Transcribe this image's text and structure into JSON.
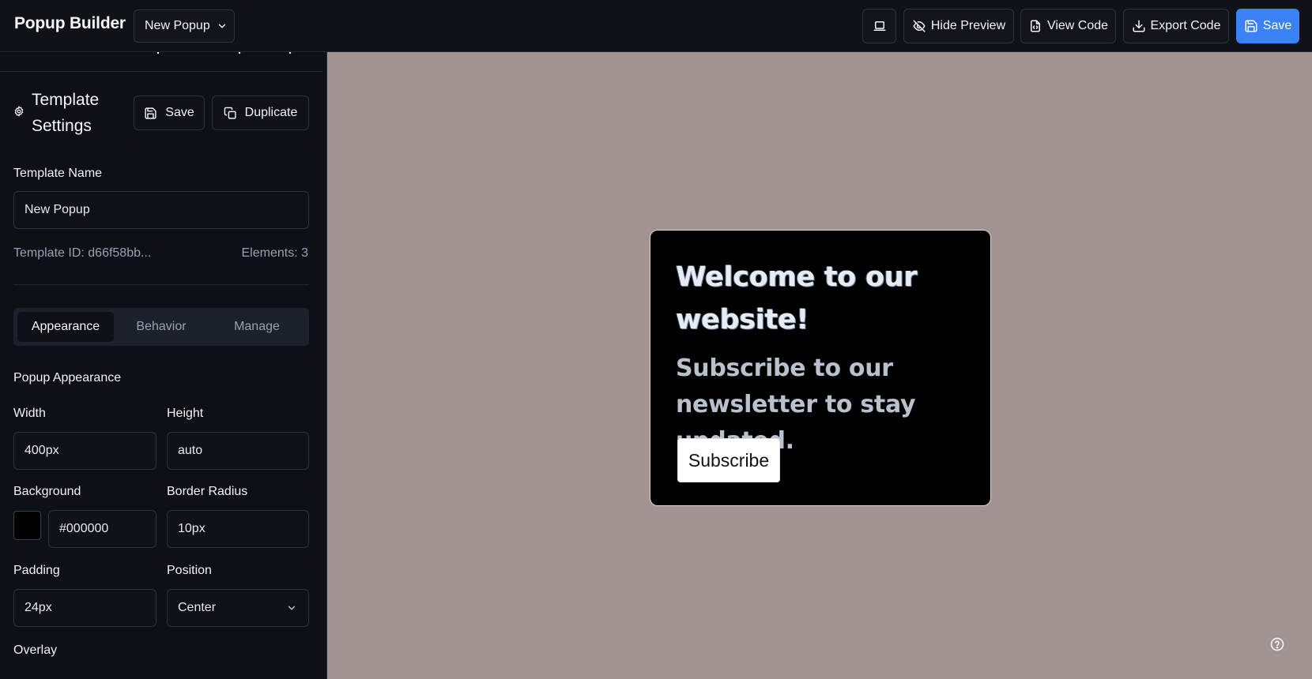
{
  "header": {
    "app_title": "Popup Builder",
    "popup_select": "New Popup",
    "device_icon": "laptop-icon",
    "hide_preview": "Hide Preview",
    "view_code": "View Code",
    "export_code": "Export Code",
    "save": "Save"
  },
  "sidebar": {
    "title": "Template Settings",
    "save": "Save",
    "duplicate": "Duplicate",
    "template_name_label": "Template Name",
    "template_name_value": "New Popup",
    "template_id_label": "Template ID:",
    "template_id_value": "d66f58bb...",
    "elements_label": "Elements:",
    "elements_value": "3",
    "tabs": [
      "Appearance",
      "Behavior",
      "Manage"
    ],
    "active_tab": "Appearance",
    "section_title": "Popup Appearance",
    "width_label": "Width",
    "width_value": "400px",
    "height_label": "Height",
    "height_value": "auto",
    "background_label": "Background",
    "background_value": "#000000",
    "border_radius_label": "Border Radius",
    "border_radius_value": "10px",
    "padding_label": "Padding",
    "padding_value": "24px",
    "position_label": "Position",
    "position_value": "Center",
    "overlay_label": "Overlay"
  },
  "preview": {
    "heading": "Welcome to our website!",
    "text": "Subscribe to our newsletter to stay updated.",
    "button": "Subscribe"
  },
  "colors": {
    "accent": "#3b82f6",
    "preview_bg": "#a29292",
    "popup_bg": "#000000"
  }
}
